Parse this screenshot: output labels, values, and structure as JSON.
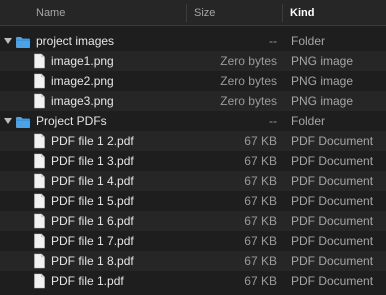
{
  "header": {
    "name": "Name",
    "size": "Size",
    "kind": "Kind"
  },
  "rows": [
    {
      "type": "folder",
      "name": "project images",
      "size": "--",
      "kind": "Folder"
    },
    {
      "type": "file",
      "name": "image1.png",
      "size": "Zero bytes",
      "kind": "PNG image"
    },
    {
      "type": "file",
      "name": "image2.png",
      "size": "Zero bytes",
      "kind": "PNG image"
    },
    {
      "type": "file",
      "name": "image3.png",
      "size": "Zero bytes",
      "kind": "PNG image"
    },
    {
      "type": "folder",
      "name": "Project PDFs",
      "size": "--",
      "kind": "Folder"
    },
    {
      "type": "file",
      "name": "PDF file 1 2.pdf",
      "size": "67 KB",
      "kind": "PDF Document"
    },
    {
      "type": "file",
      "name": "PDF file 1 3.pdf",
      "size": "67 KB",
      "kind": "PDF Document"
    },
    {
      "type": "file",
      "name": "PDF file 1 4.pdf",
      "size": "67 KB",
      "kind": "PDF Document"
    },
    {
      "type": "file",
      "name": "PDF file 1 5.pdf",
      "size": "67 KB",
      "kind": "PDF Document"
    },
    {
      "type": "file",
      "name": "PDF file 1 6.pdf",
      "size": "67 KB",
      "kind": "PDF Document"
    },
    {
      "type": "file",
      "name": "PDF file 1 7.pdf",
      "size": "67 KB",
      "kind": "PDF Document"
    },
    {
      "type": "file",
      "name": "PDF file 1 8.pdf",
      "size": "67 KB",
      "kind": "PDF Document"
    },
    {
      "type": "file",
      "name": "PDF file 1.pdf",
      "size": "67 KB",
      "kind": "PDF Document"
    }
  ],
  "colors": {
    "folder": "#4aa3e8",
    "background": "#1e1e1e",
    "stripe": "#262626"
  },
  "icons": {
    "folder": "folder-icon",
    "file": "document-icon",
    "disclosure": "disclosure-triangle-icon"
  }
}
